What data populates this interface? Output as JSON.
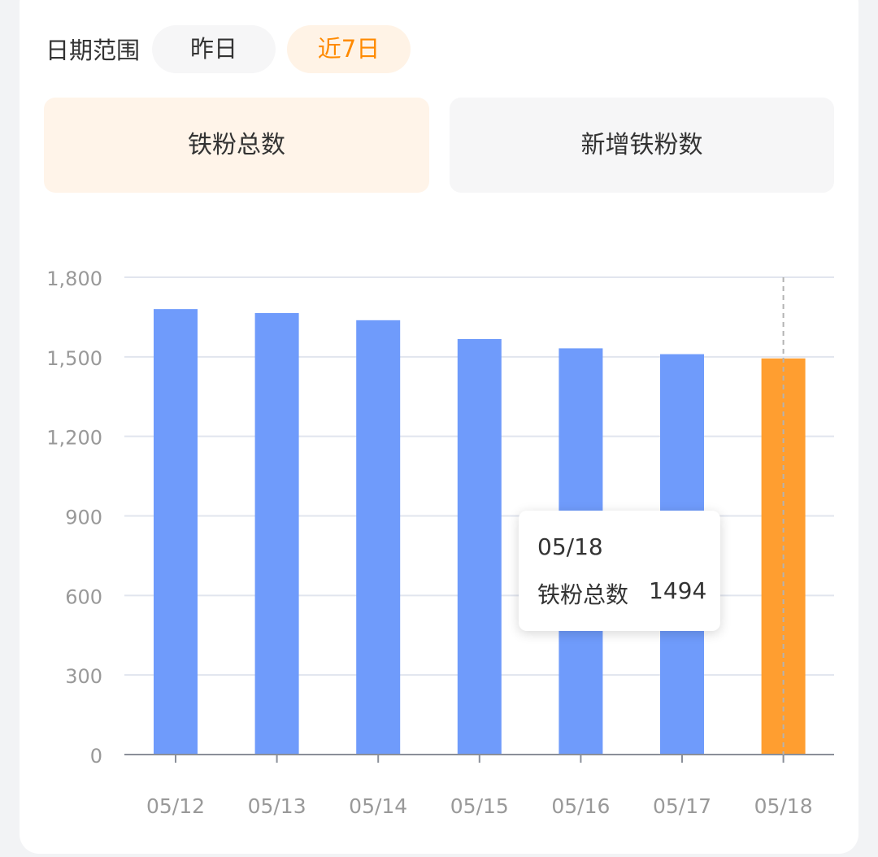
{
  "filters": {
    "range_label": "日期范围",
    "options": [
      "昨日",
      "近7日"
    ],
    "selected": "近7日"
  },
  "metric_tabs": {
    "tabs": [
      "铁粉总数",
      "新增铁粉数"
    ],
    "selected": "铁粉总数"
  },
  "tooltip": {
    "date": "05/18",
    "series": "铁粉总数",
    "value": "1494"
  },
  "colors": {
    "bar": "#6f9bfb",
    "bar_highlight": "#ff9e30",
    "accent": "#ff8a00",
    "selected_tab_bg": "#fff4e9"
  },
  "chart_data": {
    "type": "bar",
    "categories": [
      "05/12",
      "05/13",
      "05/14",
      "05/15",
      "05/16",
      "05/17",
      "05/18"
    ],
    "series": [
      {
        "name": "铁粉总数",
        "values": [
          1680,
          1665,
          1638,
          1567,
          1532,
          1510,
          1494
        ]
      }
    ],
    "highlight_index": 6,
    "ylim": [
      0,
      1800
    ],
    "yticks": [
      0,
      300,
      600,
      900,
      1200,
      1500,
      1800
    ],
    "ytick_labels": [
      "0",
      "300",
      "600",
      "900",
      "1,200",
      "1,500",
      "1,800"
    ],
    "grid": true
  }
}
